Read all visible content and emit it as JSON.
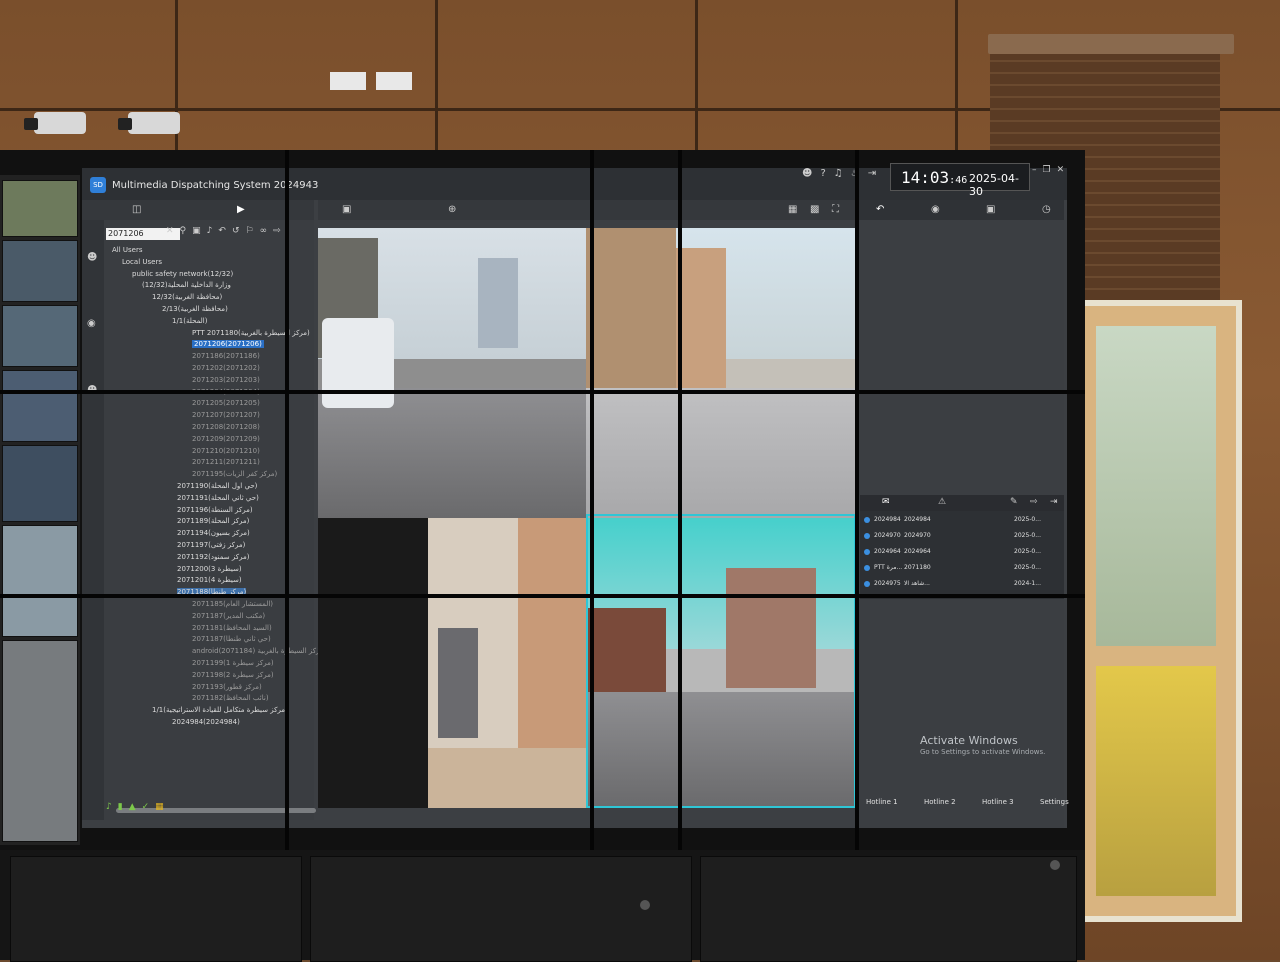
{
  "app": {
    "title": "Multimedia Dispatching System 2024943",
    "logo_text": "SD",
    "clock_time_main": "14:03",
    "clock_time_sec": ":46",
    "clock_date": "2025-04-30"
  },
  "search": {
    "value": "2071206"
  },
  "tree": {
    "items": [
      {
        "label": "All Users"
      },
      {
        "label": "Local Users"
      },
      {
        "label": "public safety network(12/32)"
      },
      {
        "label": "وزارة الداخلية المحلية(12/32)"
      },
      {
        "label": "12/32(محافظة الغربية)"
      },
      {
        "label": "2/13(محافظة الغربية)"
      },
      {
        "label": "1/1(المحلة)"
      },
      {
        "label": "PTT 2071180(مركز السيطرة بالغربية)"
      },
      {
        "label": "2071206(2071206)"
      },
      {
        "label": "2071186(2071186)"
      },
      {
        "label": "2071202(2071202)"
      },
      {
        "label": "2071203(2071203)"
      },
      {
        "label": "2071204(2071204)"
      },
      {
        "label": "2071205(2071205)"
      },
      {
        "label": "2071207(2071207)"
      },
      {
        "label": "2071208(2071208)"
      },
      {
        "label": "2071209(2071209)"
      },
      {
        "label": "2071210(2071210)"
      },
      {
        "label": "2071211(2071211)"
      },
      {
        "label": "2071195(مركز كفر الزيات)"
      },
      {
        "label": "2071190(حي اول المحلة)"
      },
      {
        "label": "2071191(حي ثاني المحلة)"
      },
      {
        "label": "2071196(مركز السنطة)"
      },
      {
        "label": "2071189(مركز المحلة)"
      },
      {
        "label": "2071194(مركز بسيون)"
      },
      {
        "label": "2071197(مركز زفتى)"
      },
      {
        "label": "2071192(مركز سمنود)"
      },
      {
        "label": "2071200(سيطرة 3)"
      },
      {
        "label": "2071201(سيطرة 4)"
      },
      {
        "label": "2071188(مركز طنطا)"
      },
      {
        "label": "2071185(المستشار العام)"
      },
      {
        "label": "2071187(مكتب المدير)"
      },
      {
        "label": "2071181(السيد المحافظ)"
      },
      {
        "label": "2071187(حي ثاني طنطا)"
      },
      {
        "label": "android(2071184) مركز السيطرة بالغربية"
      },
      {
        "label": "2071199(مركز سيطرة 1)"
      },
      {
        "label": "2071198(مركز سيطرة 2)"
      },
      {
        "label": "2071193(مركز قطور)"
      },
      {
        "label": "2071182(نائب المحافظ)"
      },
      {
        "label": "1/1(مركز سيطرة متكامل للقيادة الاستراتيجية)"
      },
      {
        "label": "2024984(2024984)"
      }
    ]
  },
  "messages": [
    {
      "from": "2024984",
      "id": "2024984",
      "date": "2025-0..."
    },
    {
      "from": "2024970",
      "id": "2024970",
      "date": "2025-0..."
    },
    {
      "from": "2024964",
      "id": "2024964",
      "date": "2025-0..."
    },
    {
      "from": "PTT مرة...",
      "id": "2071180",
      "date": "2025-0..."
    },
    {
      "from": "2024975",
      "id": "2024975",
      "date": "2024-1...",
      "note": "شاهد الا..."
    }
  ],
  "watermark": {
    "title": "Activate Windows",
    "subtitle": "Go to Settings to activate Windows."
  },
  "hotlines": {
    "h1": "Hotline 1",
    "h2": "Hotline 2",
    "h3": "Hotline 3",
    "settings": "Settings"
  },
  "colors": {
    "accent": "#2a6fc4",
    "selected_video_border": "#2ec6d6",
    "app_bg": "#3c3f43"
  }
}
